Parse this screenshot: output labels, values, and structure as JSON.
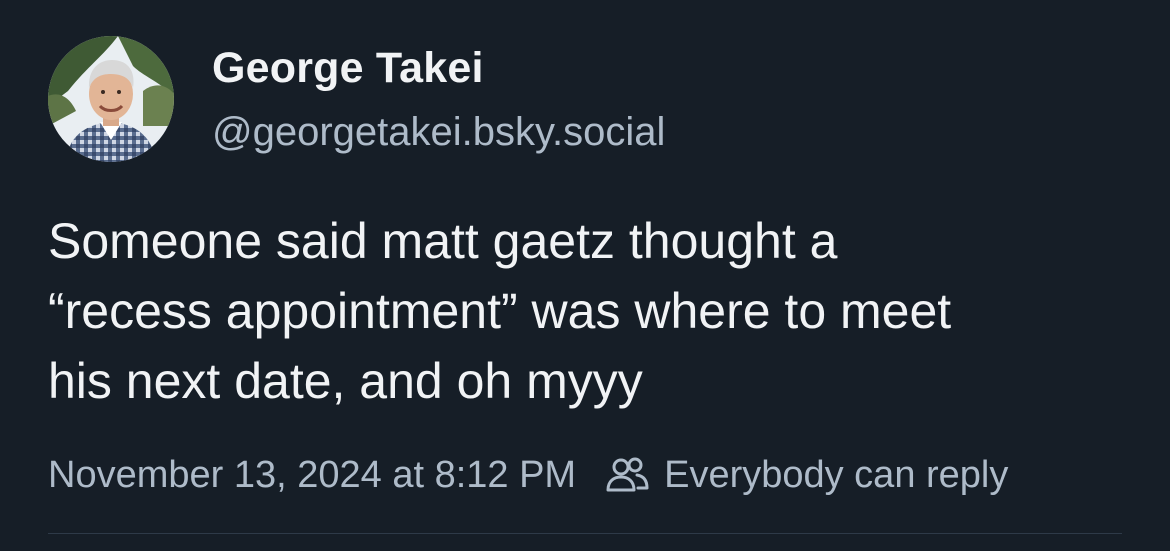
{
  "author": {
    "display_name": "George Takei",
    "handle": "@georgetakei.bsky.social",
    "avatar_icon": "profile-photo"
  },
  "post": {
    "lines": [
      "Someone said matt gaetz thought a",
      "“recess appointment” was where to meet",
      "his next date, and oh myyy"
    ]
  },
  "meta": {
    "timestamp": "November 13, 2024 at 8:12 PM",
    "reply_setting": "Everybody can reply",
    "reply_icon": "people-icon"
  },
  "colors": {
    "background": "#161e27",
    "primary_text": "#f1f3f5",
    "secondary_text": "#aebbc9",
    "divider": "#2e3a48"
  }
}
